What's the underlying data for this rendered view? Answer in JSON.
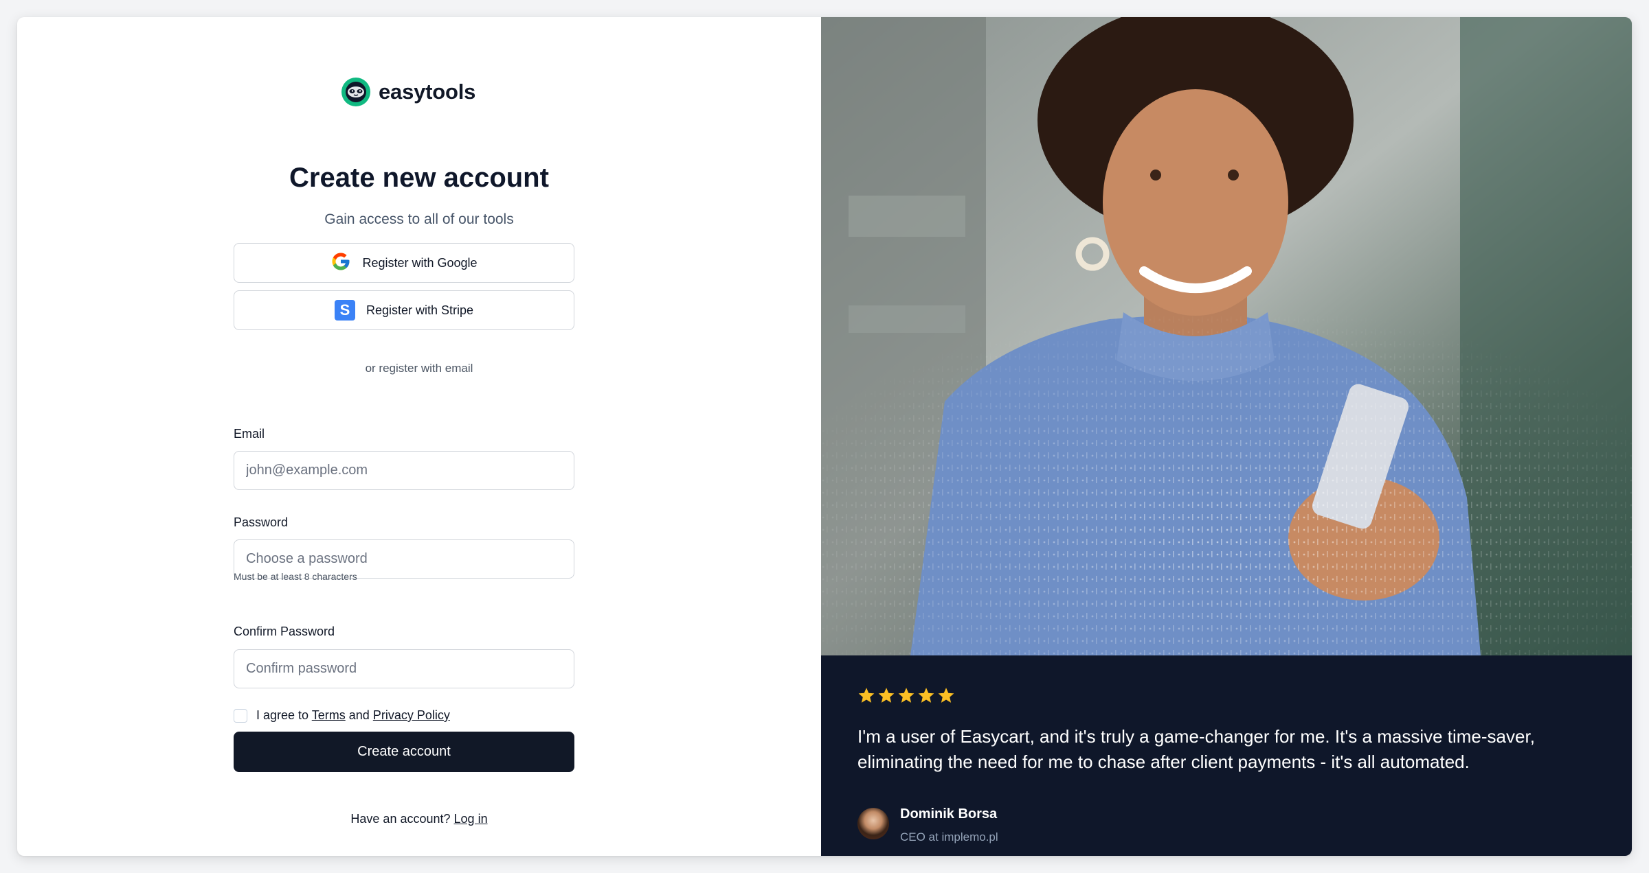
{
  "brand": {
    "name": "easytools",
    "accent_color": "#10b981"
  },
  "form": {
    "title": "Create new account",
    "subtitle": "Gain access to all of our tools",
    "google_label": "Register with Google",
    "stripe_label": "Register with Stripe",
    "divider_text": "or register with email",
    "email": {
      "label": "Email",
      "placeholder": "john@example.com",
      "value": ""
    },
    "password": {
      "label": "Password",
      "placeholder": "Choose a password",
      "hint": "Must be at least 8 characters",
      "value": ""
    },
    "confirm_password": {
      "label": "Confirm Password",
      "placeholder": "Confirm password",
      "value": ""
    },
    "agree": {
      "prefix": "I agree to",
      "terms": "Terms",
      "and": "and",
      "privacy": "Privacy Policy",
      "checked": false
    },
    "submit_label": "Create account",
    "login_prompt": "Have an account?",
    "login_link": "Log in"
  },
  "testimonial": {
    "rating": 5,
    "star_color": "#fbbf24",
    "quote": "I'm a user of Easycart, and it's truly a game-changer for me. It's a massive time-saver, eliminating the need for me to chase after client payments - it's all automated.",
    "author_name": "Dominik Borsa",
    "author_role": "CEO at implemo.pl"
  },
  "colors": {
    "primary_button": "#111827",
    "testimonial_bg": "#0f172a"
  }
}
